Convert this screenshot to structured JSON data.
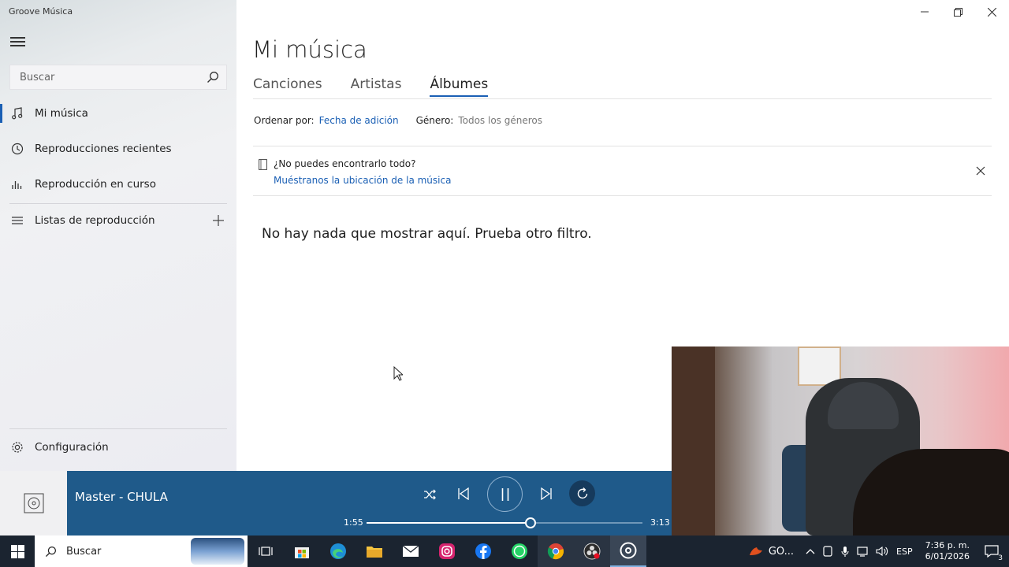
{
  "window": {
    "app_title": "Groove Música",
    "minimize_icon": "minimize-icon",
    "restore_icon": "restore-icon",
    "close_icon": "close-icon"
  },
  "sidebar": {
    "search_placeholder": "Buscar",
    "items": [
      {
        "label": "Mi música",
        "icon": "music-note-icon",
        "active": true
      },
      {
        "label": "Reproducciones recientes",
        "icon": "clock-icon"
      },
      {
        "label": "Reproducción en curso",
        "icon": "equalizer-bars-icon"
      },
      {
        "label": "Listas de reproducción",
        "icon": "list-icon"
      }
    ],
    "settings_label": "Configuración"
  },
  "main": {
    "page_title": "Mi música",
    "tabs": [
      {
        "label": "Canciones"
      },
      {
        "label": "Artistas"
      },
      {
        "label": "Álbumes",
        "active": true
      }
    ],
    "sort": {
      "label": "Ordenar por:",
      "value": "Fecha de adición",
      "genre_label": "Género:",
      "genre_value": "Todos los géneros"
    },
    "notice": {
      "question": "¿No puedes encontrarlo todo?",
      "link": "Muéstranos la ubicación de la música"
    },
    "empty_message": "No hay nada que mostrar aquí. Prueba otro filtro."
  },
  "player": {
    "track": "Master - CHULA",
    "elapsed": "1:55",
    "duration": "3:13",
    "progress_fraction": 0.594
  },
  "taskbar": {
    "search_label": "Buscar",
    "weather_text": "GO...",
    "language": "ESP",
    "time": "7:36 p. m.",
    "date": "6/01/2026",
    "notification_count": "3"
  },
  "colors": {
    "accent": "#1a5fb4",
    "player_bg": "#1f5a8a",
    "taskbar_bg": "#1b2430"
  }
}
